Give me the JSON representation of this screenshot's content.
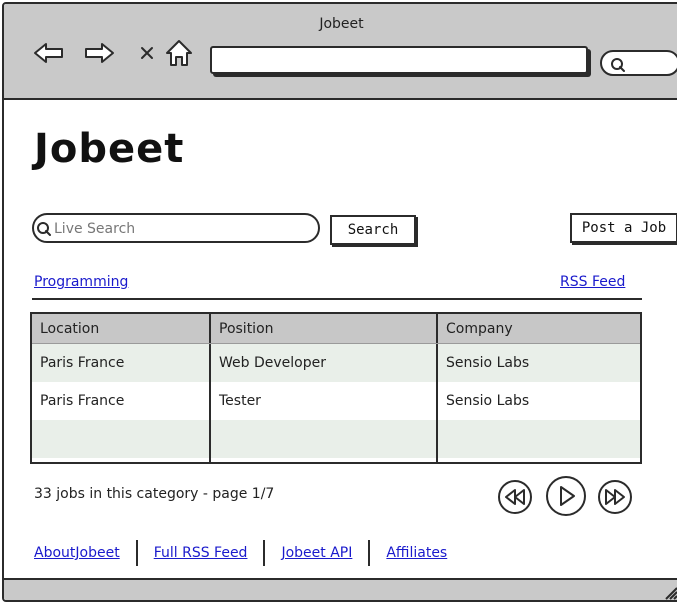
{
  "window": {
    "title": "Jobeet"
  },
  "browser": {
    "back_icon": "left-arrow-icon",
    "forward_icon": "right-arrow-icon",
    "stop_icon": "close-icon",
    "home_icon": "home-icon",
    "url": "",
    "search_icon": "search-icon"
  },
  "page": {
    "logo": "Jobeet",
    "search": {
      "placeholder": "Live Search",
      "button": "Search"
    },
    "post_job": "Post a Job",
    "category": "Programming",
    "rss_feed": "RSS Feed",
    "table": {
      "headers": [
        "Location",
        "Position",
        "Company"
      ],
      "rows": [
        [
          "Paris France",
          "Web Developer",
          "Sensio Labs"
        ],
        [
          "Paris France",
          "Tester",
          "Sensio Labs"
        ],
        [
          "",
          "",
          ""
        ]
      ]
    },
    "summary": "33 jobs in this category - page 1/7",
    "pager": {
      "current_page": 1,
      "total_pages": 7
    },
    "footer_links": [
      "AboutJobeet",
      "Full RSS Feed",
      "Jobeet API",
      "Affiliates"
    ]
  }
}
